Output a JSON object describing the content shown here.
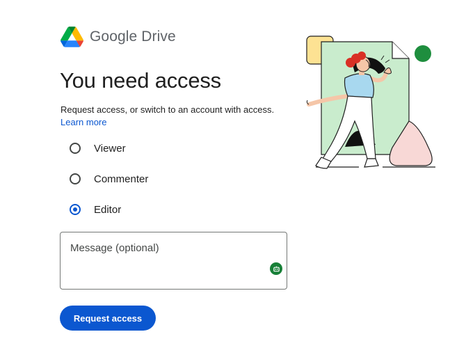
{
  "brand": {
    "name": "Google Drive",
    "logo_icon": "google-drive-logo-icon"
  },
  "title": "You need access",
  "description": "Request access, or switch to an account with access.",
  "learn_more": "Learn more",
  "roles": [
    {
      "label": "Viewer",
      "selected": false
    },
    {
      "label": "Commenter",
      "selected": false
    },
    {
      "label": "Editor",
      "selected": true
    }
  ],
  "message": {
    "placeholder": "Message (optional)",
    "value": "",
    "badge_icon": "grammarly-assist-icon"
  },
  "request_button": "Request access",
  "colors": {
    "primary": "#0b57d0",
    "badge_green": "#188038",
    "illustration_green": "#c9eccd",
    "illustration_pink": "#f8d8d6",
    "illustration_yellow": "#fde293"
  }
}
